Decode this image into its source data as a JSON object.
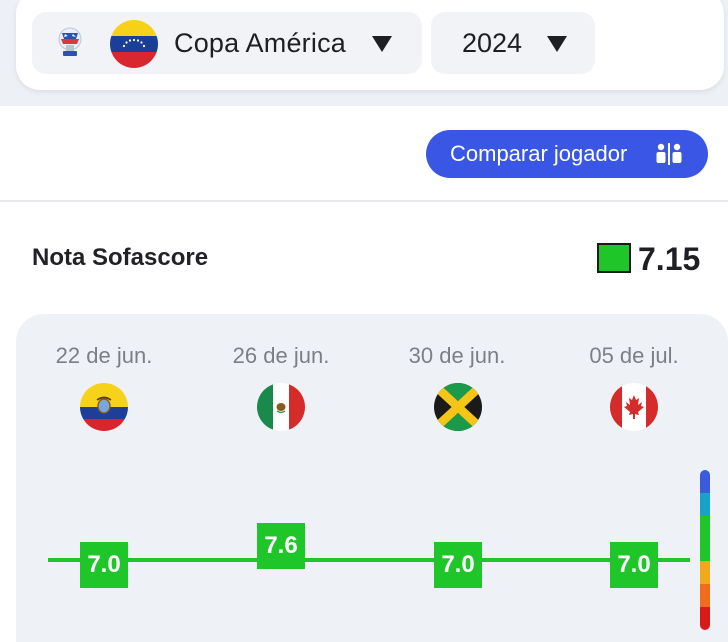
{
  "filters": {
    "league": {
      "name": "Copa América",
      "icon": "copa-america-trophy-icon",
      "flag": "venezuela-flag"
    },
    "season": {
      "value": "2024"
    }
  },
  "actions": {
    "compare_label": "Comparar jogador",
    "compare_icon": "compare-players-icon",
    "accent_color": "#3a56e4"
  },
  "rating": {
    "title": "Nota Sofascore",
    "value": "7.15",
    "color": "#1fc62a"
  },
  "matches": [
    {
      "date": "22 de jun.",
      "opponent_flag": "ecuador-flag",
      "rating": "7.0"
    },
    {
      "date": "26 de jun.",
      "opponent_flag": "mexico-flag",
      "rating": "7.6"
    },
    {
      "date": "30 de jun.",
      "opponent_flag": "jamaica-flag",
      "rating": "7.0"
    },
    {
      "date": "05 de jul.",
      "opponent_flag": "canada-flag",
      "rating": "7.0"
    }
  ],
  "rating_scale_colors": [
    "#3b5bdb",
    "#17a2c8",
    "#1fc62a",
    "#1fc62a",
    "#f0a91b",
    "#f06b1b",
    "#d91a1a"
  ]
}
